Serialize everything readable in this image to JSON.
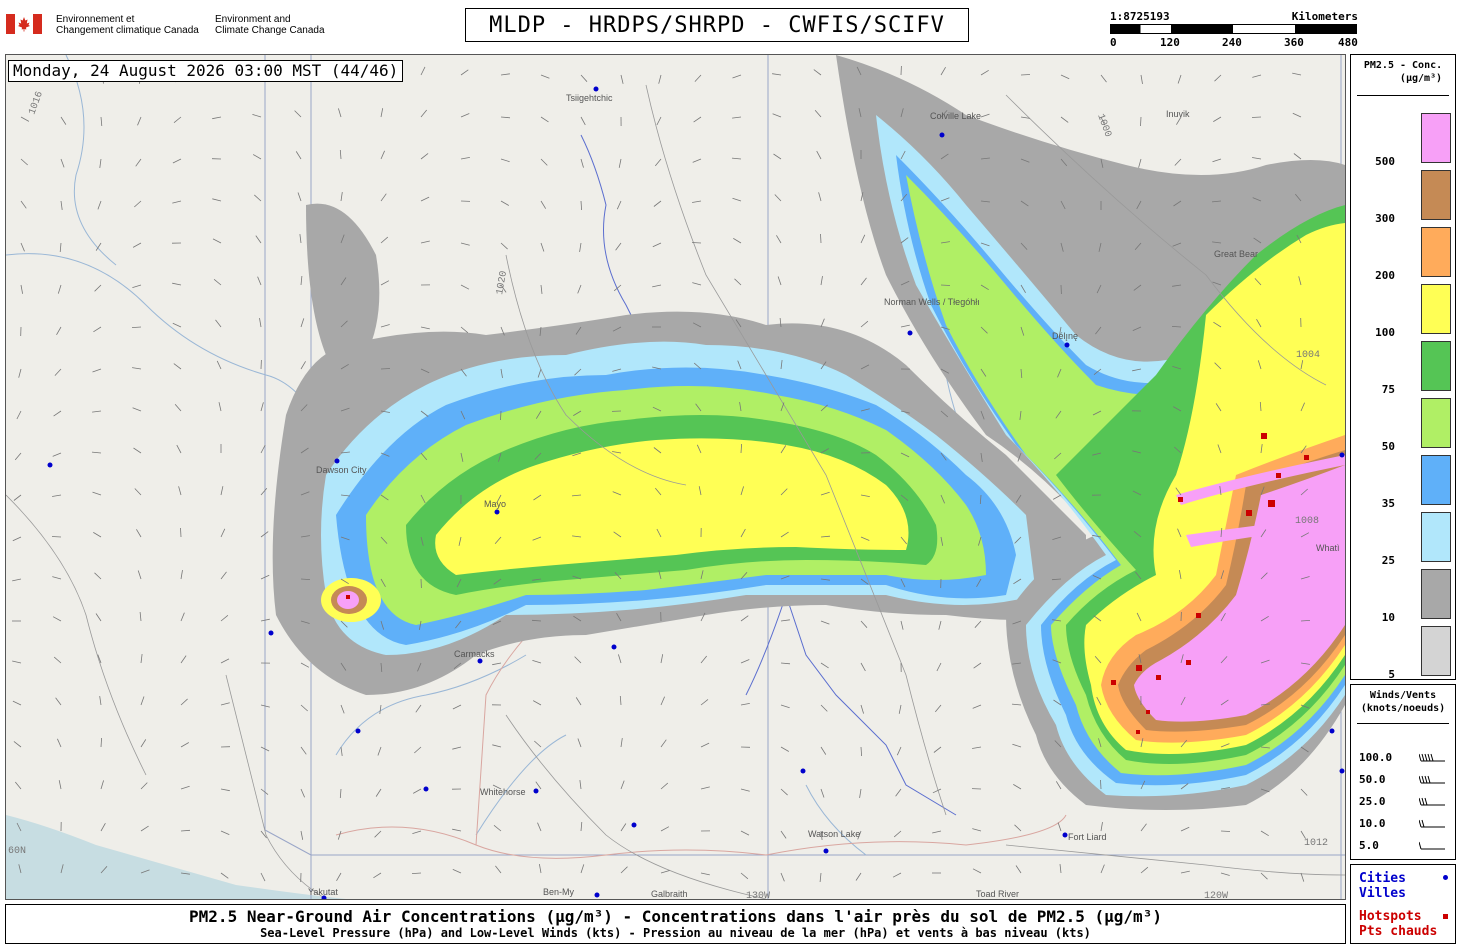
{
  "header": {
    "agency_fr_line1": "Environnement et",
    "agency_fr_line2": "Changement climatique Canada",
    "agency_en_line1": "Environment and",
    "agency_en_line2": "Climate Change Canada",
    "main_title": "MLDP - HRDPS/SHRPD - CWFIS/SCIFV",
    "flag_icon": "canada-flag-icon"
  },
  "scalebar": {
    "ratio": "1:8725193",
    "unit": "Kilometers",
    "ticks": [
      "0",
      "120",
      "240",
      "360",
      "480"
    ]
  },
  "map": {
    "timestamp": "Monday, 24 August 2026 03:00 MST (44/46)",
    "places": [
      "Tsiigehtchic",
      "Colville Lake",
      "Norman Wells / Tłegóhłı",
      "Dawson City",
      "Mayo",
      "Carmacks",
      "Whitehorse",
      "Watson Lake",
      "Fort Liard",
      "Yakutat",
      "Ben-My",
      "Galbraith",
      "Toad River",
      "Délı̨nę",
      "Great Bear",
      "Whatì",
      "Inuvik"
    ],
    "isobar_labels": [
      "1020",
      "1016",
      "1012",
      "1008",
      "1004",
      "1000"
    ],
    "meridian_labels": [
      "130W",
      "120W",
      "60N"
    ],
    "colors": {
      "background": "#efeee9",
      "water": "#c7dde2",
      "border": "#5b6ecf",
      "conc_5": "#d4d4d4",
      "conc_10": "#a8a8a8",
      "conc_25": "#b1e7fb",
      "conc_35": "#5fb0f9",
      "conc_50": "#b0ef65",
      "conc_75": "#55c555",
      "conc_100": "#ffff55",
      "conc_200": "#ffab5b",
      "conc_300": "#c58a55",
      "conc_500": "#f7a0f7",
      "hotspot": "#cc0000",
      "city": "#0000cc"
    }
  },
  "legend_conc": {
    "title_line1": "PM2.5 - Conc.",
    "title_line2": "(µg/m³)",
    "levels": [
      {
        "label": "500",
        "color": "#f7a0f7"
      },
      {
        "label": "300",
        "color": "#c58a55"
      },
      {
        "label": "200",
        "color": "#ffab5b"
      },
      {
        "label": "100",
        "color": "#ffff55"
      },
      {
        "label": "75",
        "color": "#55c555"
      },
      {
        "label": "50",
        "color": "#b0ef65"
      },
      {
        "label": "35",
        "color": "#5fb0f9"
      },
      {
        "label": "25",
        "color": "#b1e7fb"
      },
      {
        "label": "10",
        "color": "#a8a8a8"
      },
      {
        "label": "5",
        "color": "#d4d4d4"
      }
    ]
  },
  "legend_wind": {
    "title_line1": "Winds/Vents",
    "title_line2": "(knots/noeuds)",
    "rows": [
      "100.0",
      "50.0",
      "25.0",
      "10.0",
      "5.0"
    ]
  },
  "legend_keys": {
    "cities_en": "Cities",
    "cities_fr": "Villes",
    "hotspots_en": "Hotspots",
    "hotspots_fr": "Pts chauds"
  },
  "footer": {
    "line1": "PM2.5 Near-Ground Air Concentrations (µg/m³) - Concentrations dans l'air près du sol de PM2.5 (µg/m³)",
    "line2": "Sea-Level Pressure (hPa) and Low-Level Winds (kts) - Pression au niveau de la mer (hPa) et vents à bas niveau (kts)"
  }
}
